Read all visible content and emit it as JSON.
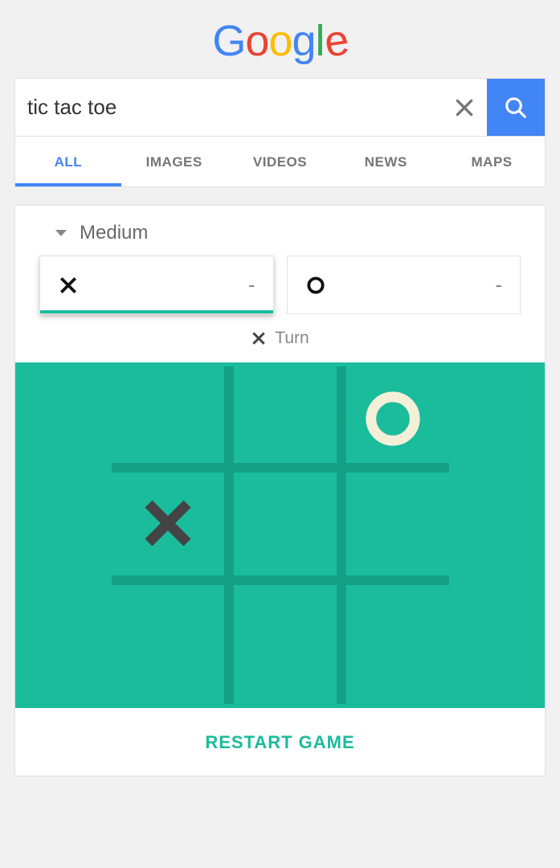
{
  "logo": "Google",
  "search": {
    "value": "tic tac toe",
    "placeholder": ""
  },
  "tabs": [
    {
      "label": "ALL",
      "active": true
    },
    {
      "label": "IMAGES",
      "active": false
    },
    {
      "label": "VIDEOS",
      "active": false
    },
    {
      "label": "NEWS",
      "active": false
    },
    {
      "label": "MAPS",
      "active": false
    }
  ],
  "game": {
    "difficulty": "Medium",
    "players": [
      {
        "symbol": "X",
        "score": "-",
        "active": true
      },
      {
        "symbol": "O",
        "score": "-",
        "active": false
      }
    ],
    "turn_symbol": "X",
    "turn_label": "Turn",
    "board": [
      [
        "",
        "",
        "O"
      ],
      [
        "X",
        "",
        ""
      ],
      [
        "",
        "",
        ""
      ]
    ],
    "restart_label": "RESTART GAME"
  },
  "colors": {
    "accent": "#4285f4",
    "board": "#1abc9c",
    "board_line": "#15a085",
    "x_mark": "#444",
    "o_mark": "#f4f0d8"
  }
}
